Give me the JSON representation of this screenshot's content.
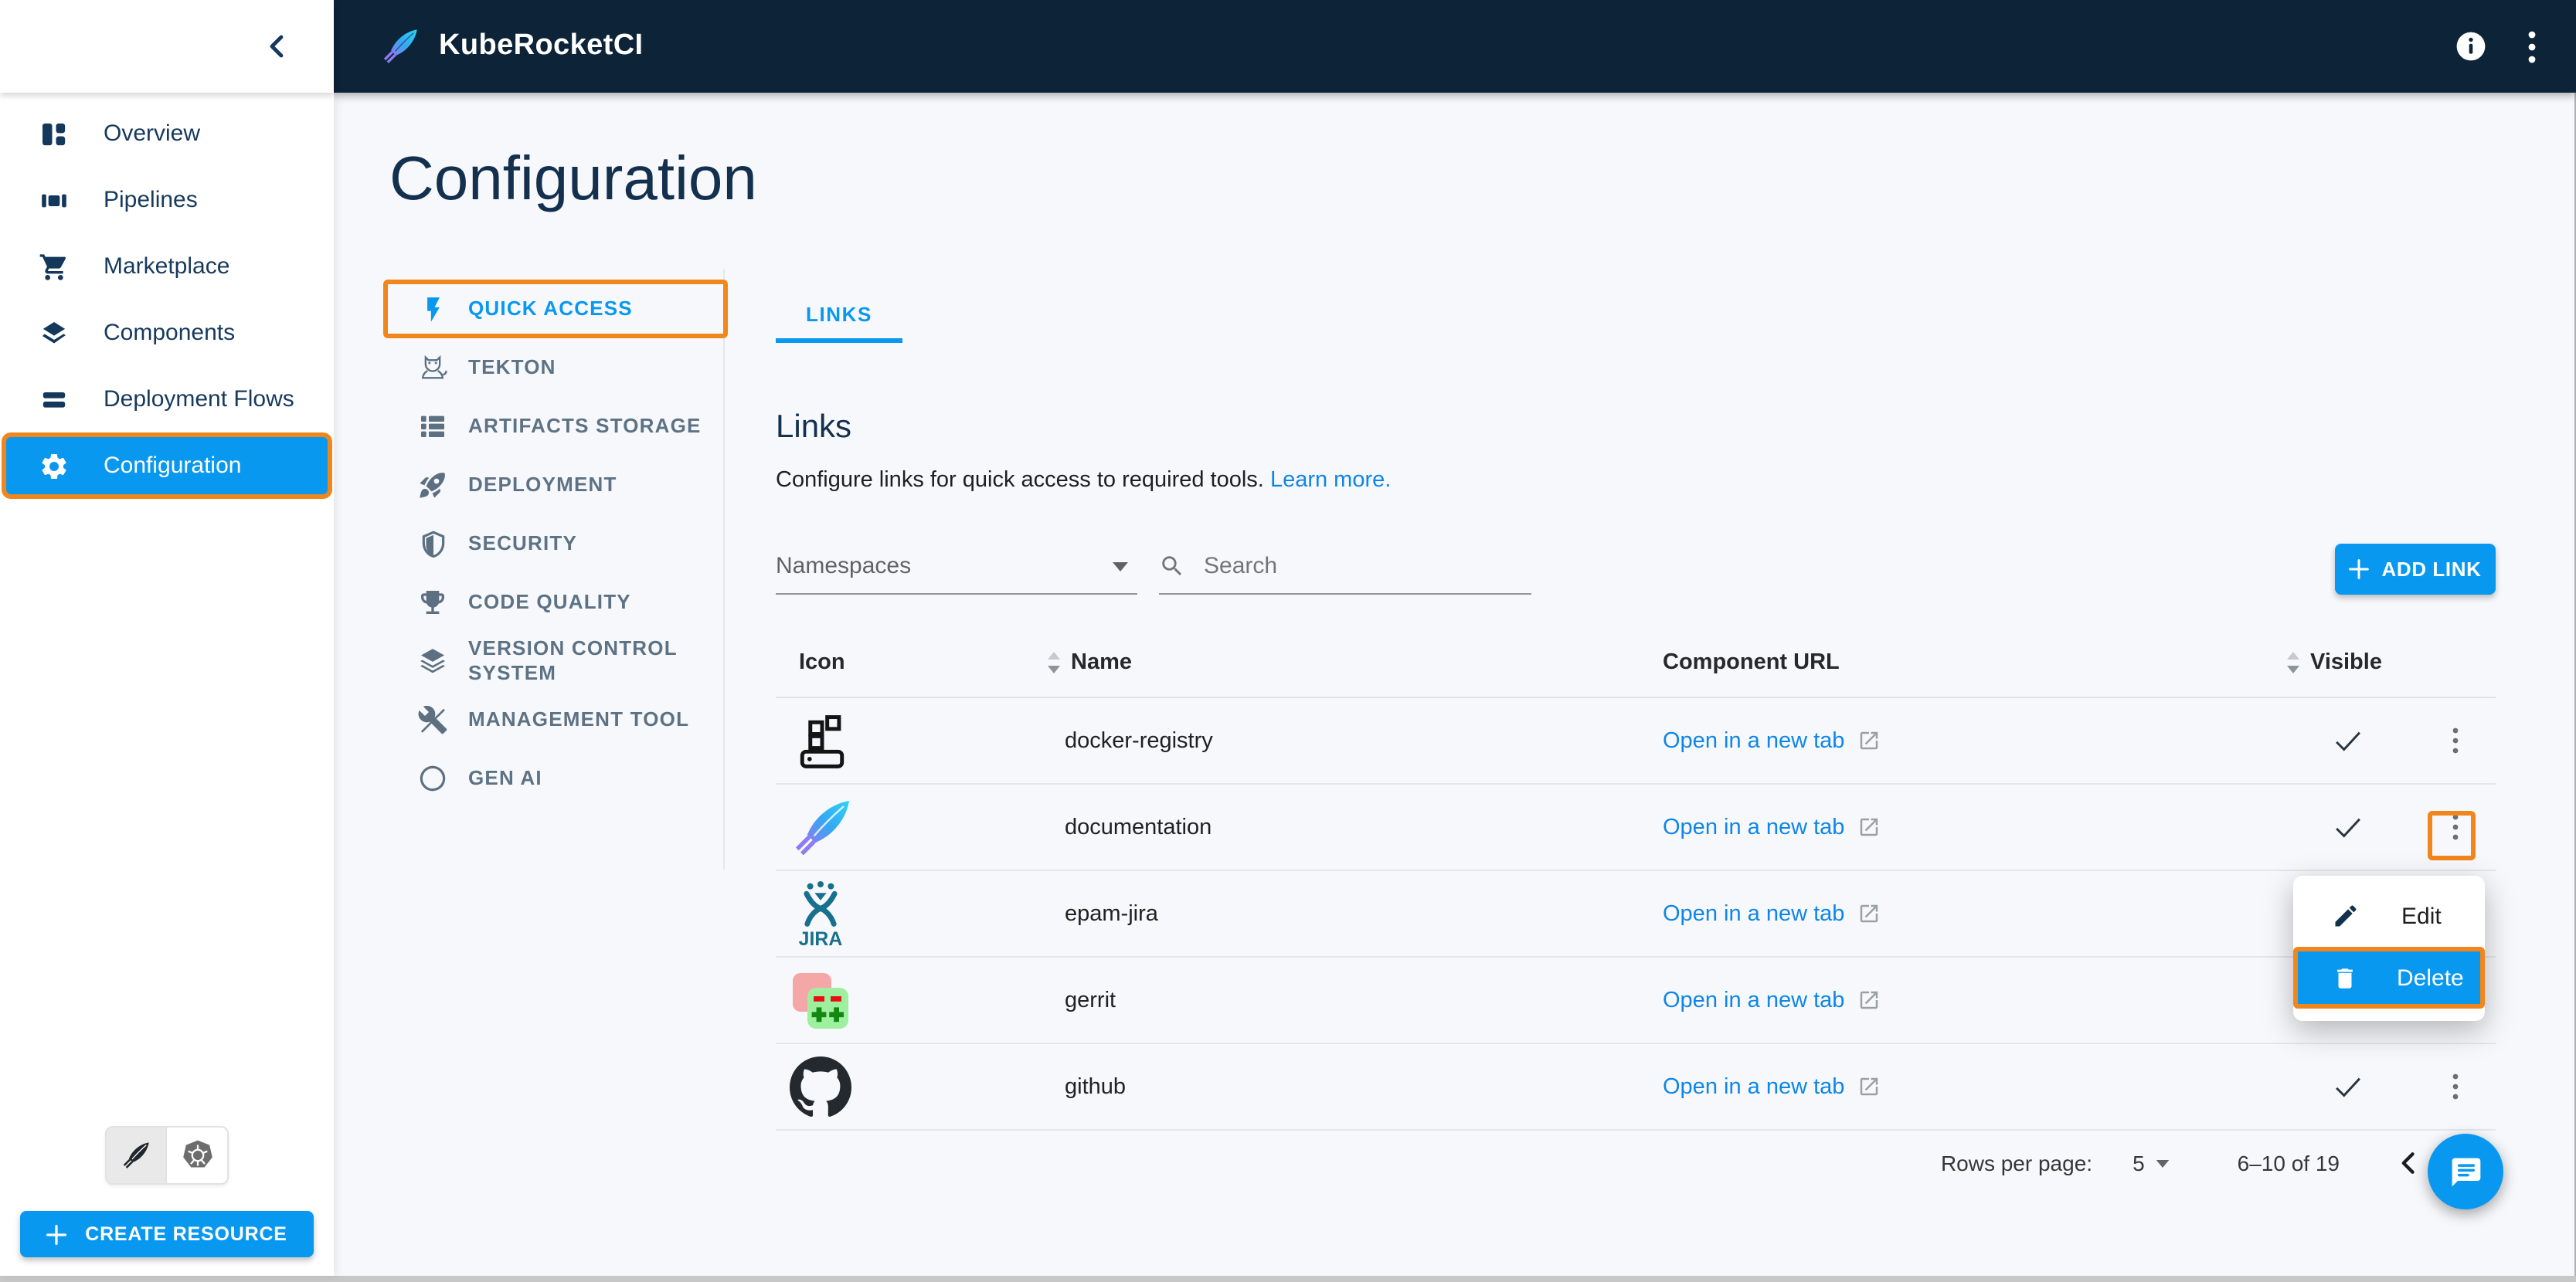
{
  "topbar": {
    "title": "KubeRocketCI"
  },
  "page": {
    "title": "Configuration"
  },
  "sidebar": {
    "items": [
      {
        "label": "Overview"
      },
      {
        "label": "Pipelines"
      },
      {
        "label": "Marketplace"
      },
      {
        "label": "Components"
      },
      {
        "label": "Deployment Flows"
      },
      {
        "label": "Configuration",
        "active": true
      }
    ],
    "create_resource_label": "CREATE RESOURCE"
  },
  "submenu": {
    "items": [
      {
        "label": "QUICK ACCESS",
        "active": true
      },
      {
        "label": "TEKTON"
      },
      {
        "label": "ARTIFACTS STORAGE"
      },
      {
        "label": "DEPLOYMENT"
      },
      {
        "label": "SECURITY"
      },
      {
        "label": "CODE QUALITY"
      },
      {
        "label": "VERSION CONTROL SYSTEM"
      },
      {
        "label": "MANAGEMENT TOOL"
      },
      {
        "label": "GEN AI"
      }
    ]
  },
  "tabs": {
    "links_label": "LINKS"
  },
  "links": {
    "heading": "Links",
    "description": "Configure links for quick access to required tools.",
    "learn_more": "Learn more."
  },
  "filters": {
    "namespaces_label": "Namespaces",
    "search_placeholder": "Search"
  },
  "actions": {
    "add_link_label": "ADD LINK"
  },
  "table": {
    "columns": {
      "icon": "Icon",
      "name": "Name",
      "url": "Component URL",
      "visible": "Visible"
    },
    "link_label": "Open in a new tab",
    "rows": [
      {
        "name": "docker-registry",
        "visible": true
      },
      {
        "name": "documentation",
        "visible": true
      },
      {
        "name": "epam-jira",
        "visible": true
      },
      {
        "name": "gerrit",
        "visible": true
      },
      {
        "name": "github",
        "visible": true
      }
    ]
  },
  "context_menu": {
    "edit_label": "Edit",
    "delete_label": "Delete"
  },
  "pagination": {
    "label": "Rows per page:",
    "value": "5",
    "range": "6–10 of 19"
  },
  "colors": {
    "accent_blue": "#0998f0",
    "header_navy": "#0d2438",
    "highlight_orange": "#f1861d",
    "link_blue": "#0e86e9"
  }
}
